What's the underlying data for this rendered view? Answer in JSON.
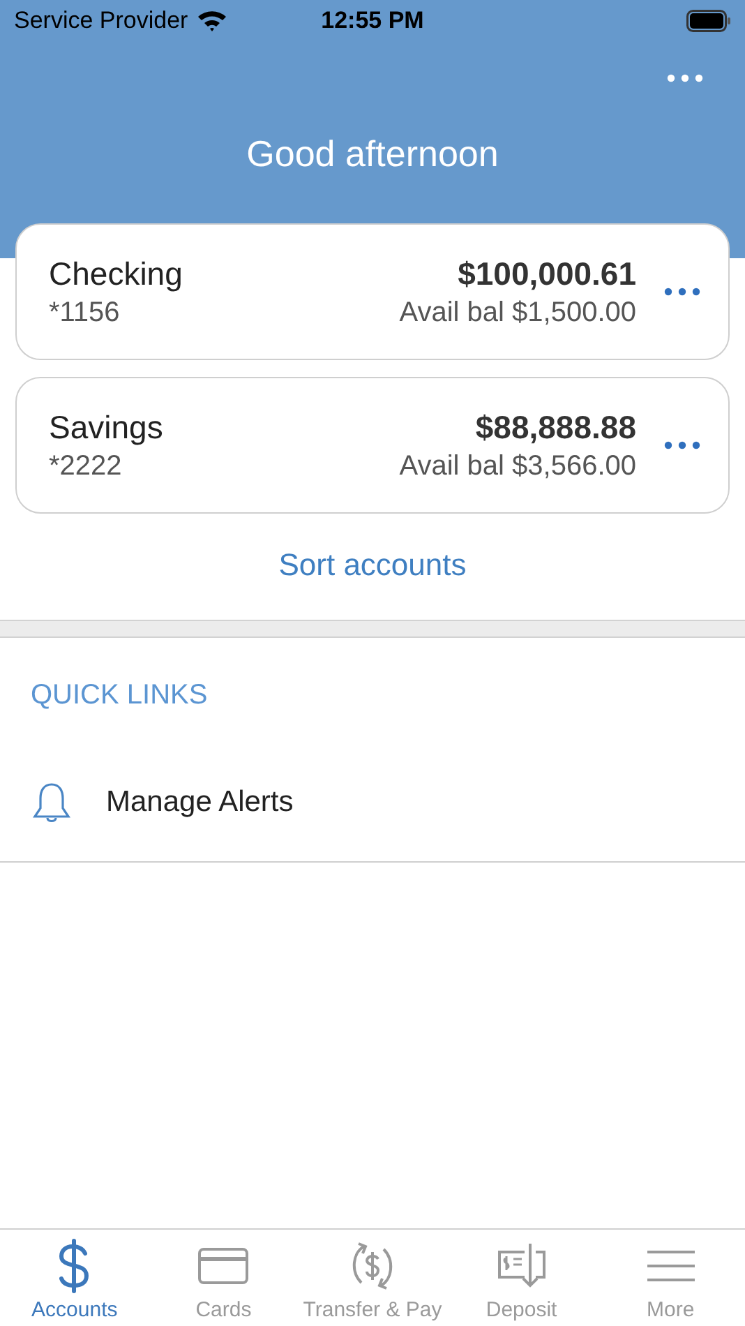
{
  "status_bar": {
    "carrier": "Service Provider",
    "time": "12:55 PM"
  },
  "header": {
    "greeting": "Good afternoon"
  },
  "accounts": [
    {
      "name": "Checking",
      "number": "*1156",
      "balance": "$100,000.61",
      "available": "Avail bal $1,500.00"
    },
    {
      "name": "Savings",
      "number": "*2222",
      "balance": "$88,888.88",
      "available": "Avail bal $3,566.00"
    }
  ],
  "sort_link": "Sort accounts",
  "quick_links": {
    "heading": "QUICK LINKS",
    "items": [
      {
        "label": "Manage Alerts",
        "kind": "alerts"
      }
    ]
  },
  "tab_bar": [
    {
      "label": "Accounts",
      "kind": "accounts",
      "selected": true
    },
    {
      "label": "Cards",
      "kind": "cards",
      "selected": false
    },
    {
      "label": "Transfer & Pay",
      "kind": "transfer",
      "selected": false
    },
    {
      "label": "Deposit",
      "kind": "deposit",
      "selected": false
    },
    {
      "label": "More",
      "kind": "more",
      "selected": false
    }
  ]
}
